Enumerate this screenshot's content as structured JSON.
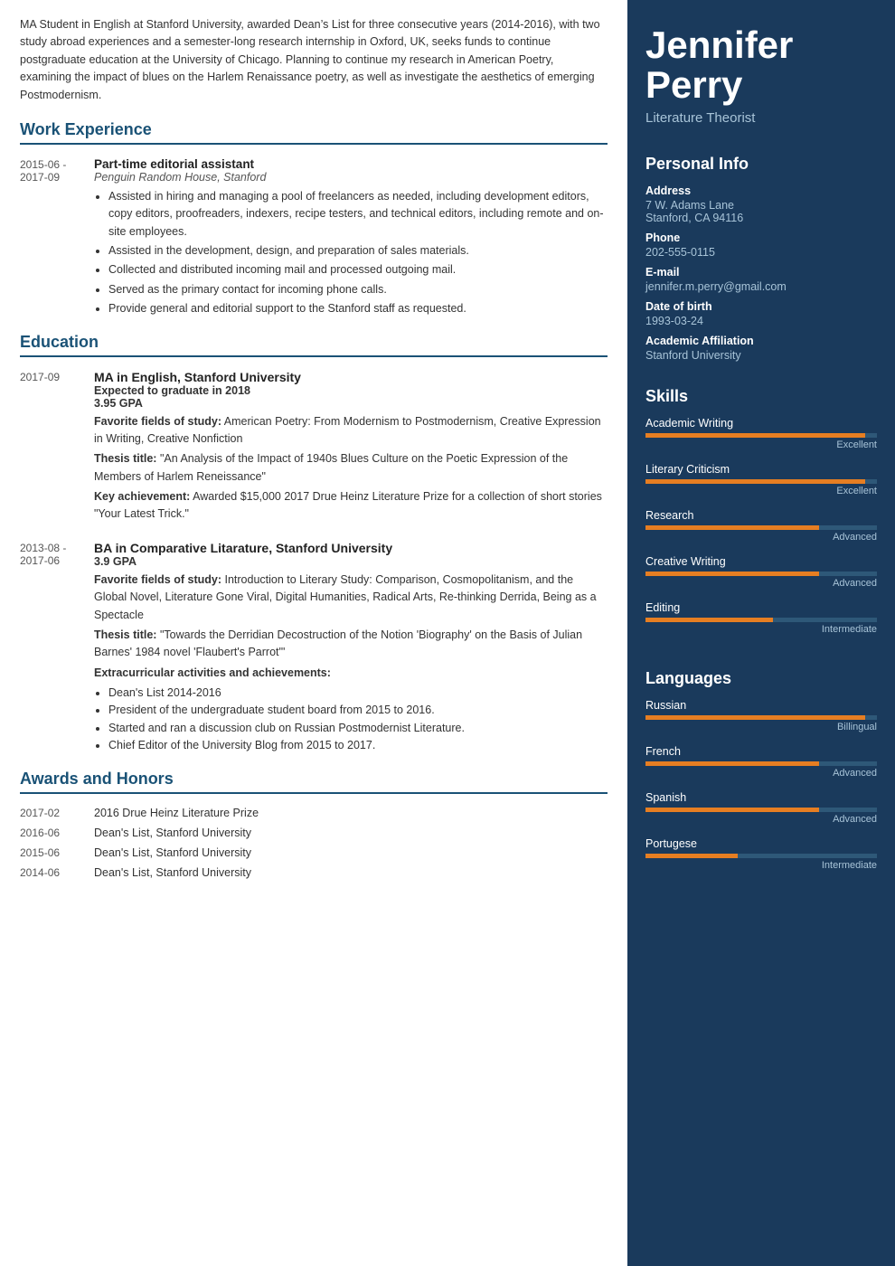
{
  "profile": {
    "first_name": "Jennifer",
    "last_name": "Perry",
    "title": "Literature Theorist"
  },
  "personal_info": {
    "section_label": "Personal Info",
    "address_label": "Address",
    "address_line1": "7 W. Adams Lane",
    "address_line2": "Stanford, CA 94116",
    "phone_label": "Phone",
    "phone": "202-555-0115",
    "email_label": "E-mail",
    "email": "jennifer.m.perry@gmail.com",
    "dob_label": "Date of birth",
    "dob": "1993-03-24",
    "affiliation_label": "Academic Affiliation",
    "affiliation": "Stanford University"
  },
  "skills": {
    "section_label": "Skills",
    "items": [
      {
        "name": "Academic Writing",
        "level": "Excellent",
        "pct": 95
      },
      {
        "name": "Literary Criticism",
        "level": "Excellent",
        "pct": 95
      },
      {
        "name": "Research",
        "level": "Advanced",
        "pct": 75
      },
      {
        "name": "Creative Writing",
        "level": "Advanced",
        "pct": 75
      },
      {
        "name": "Editing",
        "level": "Intermediate",
        "pct": 55
      }
    ]
  },
  "languages": {
    "section_label": "Languages",
    "items": [
      {
        "name": "Russian",
        "level": "Billingual",
        "pct": 95
      },
      {
        "name": "French",
        "level": "Advanced",
        "pct": 75
      },
      {
        "name": "Spanish",
        "level": "Advanced",
        "pct": 75
      },
      {
        "name": "Portugese",
        "level": "Intermediate",
        "pct": 40
      }
    ]
  },
  "summary": "MA Student in English at Stanford University, awarded Dean’s List for three consecutive years (2014-2016), with two study abroad experiences and a semester-long research internship in Oxford, UK, seeks funds to continue postgraduate education at the University of Chicago. Planning to continue my research in American Poetry, examining the impact of blues on the Harlem Renaissance poetry, as well as investigate the aesthetics of emerging Postmodernism.",
  "work_experience": {
    "section_label": "Work Experience",
    "entries": [
      {
        "date": "2015-06 - 2017-09",
        "title": "Part-time editorial assistant",
        "subtitle": "Penguin Random House, Stanford",
        "bullets": [
          "Assisted in hiring and managing a pool of freelancers as needed, including development editors, copy editors, proofreaders, indexers, recipe testers, and technical editors, including remote and on-site employees.",
          "Assisted in the development, design, and preparation of sales materials.",
          "Collected and distributed incoming mail and processed outgoing mail.",
          "Served as the primary contact for incoming phone calls.",
          "Provide general and editorial support to the Stanford staff as requested."
        ]
      }
    ]
  },
  "education": {
    "section_label": "Education",
    "entries": [
      {
        "date": "2017-09",
        "title": "MA in English, Stanford University",
        "expected": "Expected to graduate in 2018",
        "gpa": "3.95 GPA",
        "favorite": "American Poetry: From Modernism to Postmodernism, Creative Expression in Writing, Creative Nonfiction",
        "thesis": "\"An Analysis of the Impact of 1940s Blues Culture on the Poetic Expression of the Members of Harlem Reneissance\"",
        "achievement": "Awarded $15,000 2017 Drue Heinz Literature Prize for a collection of short stories \"Your Latest Trick.\""
      },
      {
        "date": "2013-08 - 2017-06",
        "title": "BA in Comparative Litarature, Stanford University",
        "gpa": "3.9 GPA",
        "favorite": "Introduction to Literary Study: Comparison, Cosmopolitanism, and the Global Novel, Literature Gone Viral, Digital Humanities, Radical Arts, Re-thinking Derrida, Being as a Spectacle",
        "thesis": "\"Towards the Derridian Decostruction of the Notion 'Biography' on the Basis of Julian Barnes' 1984 novel 'Flaubert's Parrot'\"",
        "extracurricular_label": "Extracurricular activities and achievements:",
        "extracurricular_bullets": [
          "Dean's List 2014-2016",
          "President of the undergraduate student board from 2015 to 2016.",
          "Started and ran a discussion club on Russian Postmodernist Literature.",
          "Chief Editor of the University Blog from 2015 to 2017."
        ]
      }
    ]
  },
  "awards": {
    "section_label": "Awards and Honors",
    "entries": [
      {
        "date": "2017-02",
        "text": "2016 Drue Heinz Literature Prize"
      },
      {
        "date": "2016-06",
        "text": "Dean's List, Stanford University"
      },
      {
        "date": "2015-06",
        "text": "Dean's List, Stanford University"
      },
      {
        "date": "2014-06",
        "text": "Dean's List, Stanford University"
      }
    ]
  }
}
